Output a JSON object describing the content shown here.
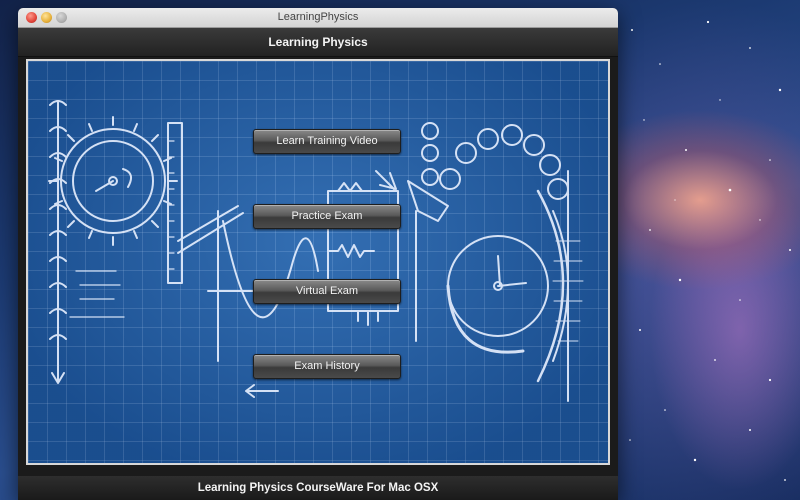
{
  "window": {
    "title": "LearningPhysics"
  },
  "header": {
    "title": "Learning Physics"
  },
  "menu": {
    "items": [
      {
        "label": "Learn Training Video"
      },
      {
        "label": "Practice Exam"
      },
      {
        "label": "Virtual Exam"
      },
      {
        "label": "Exam History"
      }
    ]
  },
  "footer": {
    "text": "Learning Physics CourseWare For Mac OSX"
  },
  "colors": {
    "blueprint": "#1f5aa0",
    "chalk": "#e8f0ff",
    "button": "#4a4a4a"
  },
  "icons": [
    "close-icon",
    "minimize-icon",
    "zoom-icon"
  ]
}
